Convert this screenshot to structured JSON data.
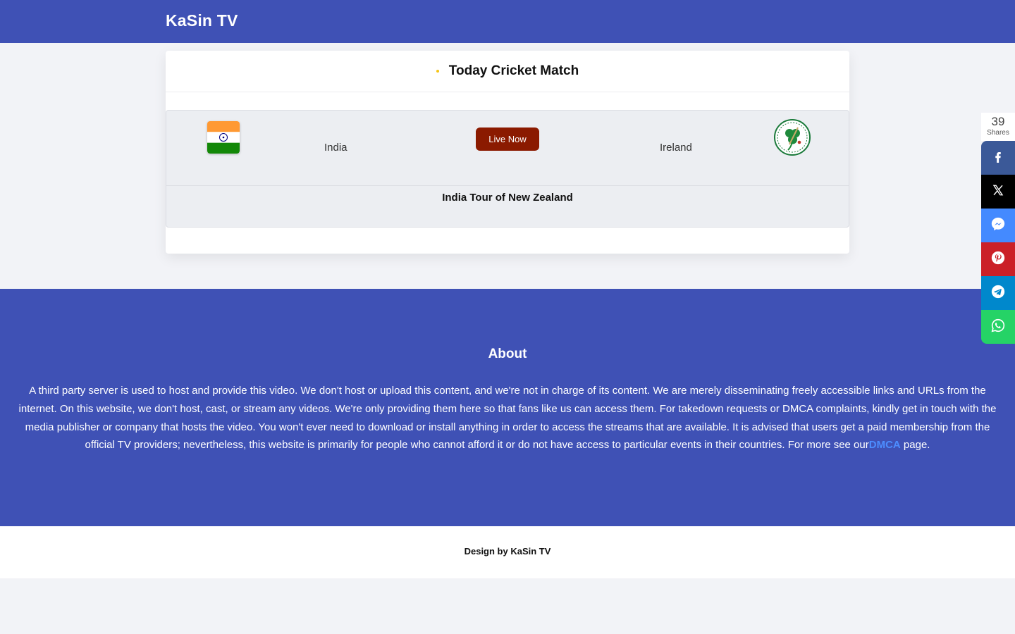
{
  "header": {
    "site_title": "KaSin TV",
    "background": "#3f51b5"
  },
  "card": {
    "title": "Today Cricket Match",
    "match": {
      "team_left": "India",
      "team_left_logo": "india-flag",
      "team_right": "Ireland",
      "team_right_logo": "ireland-cricket-logo",
      "live_label": "Live Now",
      "live_color": "#8b1a00",
      "tour": "India Tour of New Zealand"
    }
  },
  "about": {
    "title": "About",
    "text": "A third party server is used to host and provide this video. We don't host or upload this content, and we're not in charge of its content. We are merely disseminating freely accessible links and URLs from the internet. On this website, we don't host, cast, or stream any videos. We're only providing them here so that fans like us can access them. For takedown requests or DMCA complaints, kindly get in touch with the media publisher or company that hosts the video. You won't ever need to download or install anything in order to access the streams that are available. It is advised that users get a paid membership from the official TV providers; nevertheless, this website is primarily for people who cannot afford it or do not have access to particular events in their countries. For more see our",
    "link_label": "DMCA",
    "text_after": " page."
  },
  "footer": {
    "text": "Design by KaSin TV"
  },
  "share": {
    "count": "39",
    "label": "Shares",
    "buttons": [
      {
        "name": "facebook",
        "icon": "facebook-icon",
        "color": "#3b5998"
      },
      {
        "name": "twitter",
        "icon": "x-icon",
        "color": "#000000"
      },
      {
        "name": "messenger",
        "icon": "messenger-icon",
        "color": "#448aff"
      },
      {
        "name": "pinterest",
        "icon": "pinterest-icon",
        "color": "#cb2027"
      },
      {
        "name": "telegram",
        "icon": "telegram-icon",
        "color": "#0088cc"
      },
      {
        "name": "whatsapp",
        "icon": "whatsapp-icon",
        "color": "#25d366"
      }
    ]
  }
}
